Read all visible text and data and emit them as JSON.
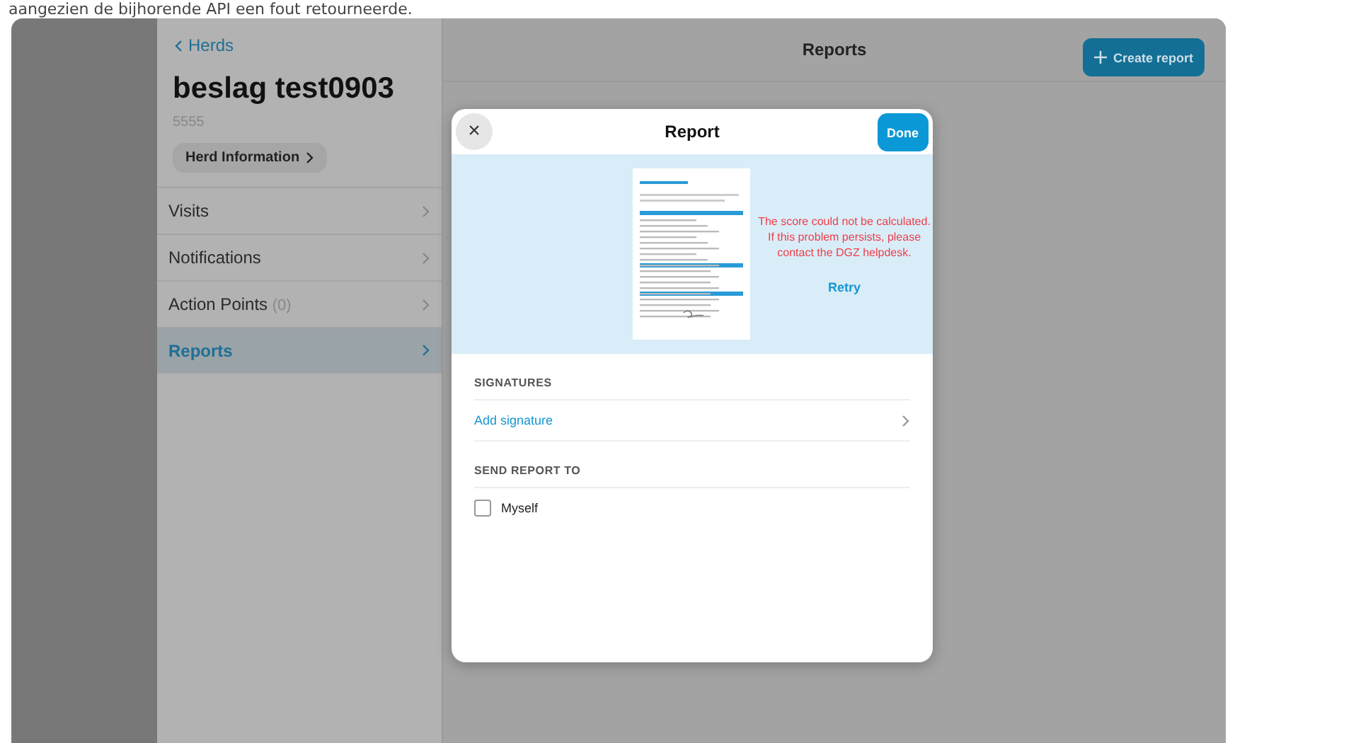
{
  "caption": "aangezien de bijhorende API een fout retourneerde.",
  "sidebar": {
    "back_link": "Herds",
    "title": "beslag test0903",
    "subtitle": "5555",
    "info_button": "Herd Information",
    "items": [
      {
        "label": "Visits",
        "selected": false
      },
      {
        "label": "Notifications",
        "selected": false
      },
      {
        "label": "Action Points",
        "count": "(0)",
        "selected": false
      },
      {
        "label": "Reports",
        "selected": true
      }
    ]
  },
  "header": {
    "title": "Reports",
    "create_button": "Create report"
  },
  "modal": {
    "title": "Report",
    "close": "×",
    "done_button": "Done",
    "preview": {
      "error": "The score could not be calculated. If this problem persists, please contact the DGZ helpdesk.",
      "retry": "Retry"
    },
    "sections": [
      {
        "heading": "SIGNATURES",
        "rows": [
          {
            "kind": "link",
            "label": "Add signature"
          }
        ]
      },
      {
        "heading": "SEND REPORT TO",
        "rows": [
          {
            "kind": "checkbox",
            "label": "Myself",
            "checked": false
          }
        ]
      }
    ]
  }
}
